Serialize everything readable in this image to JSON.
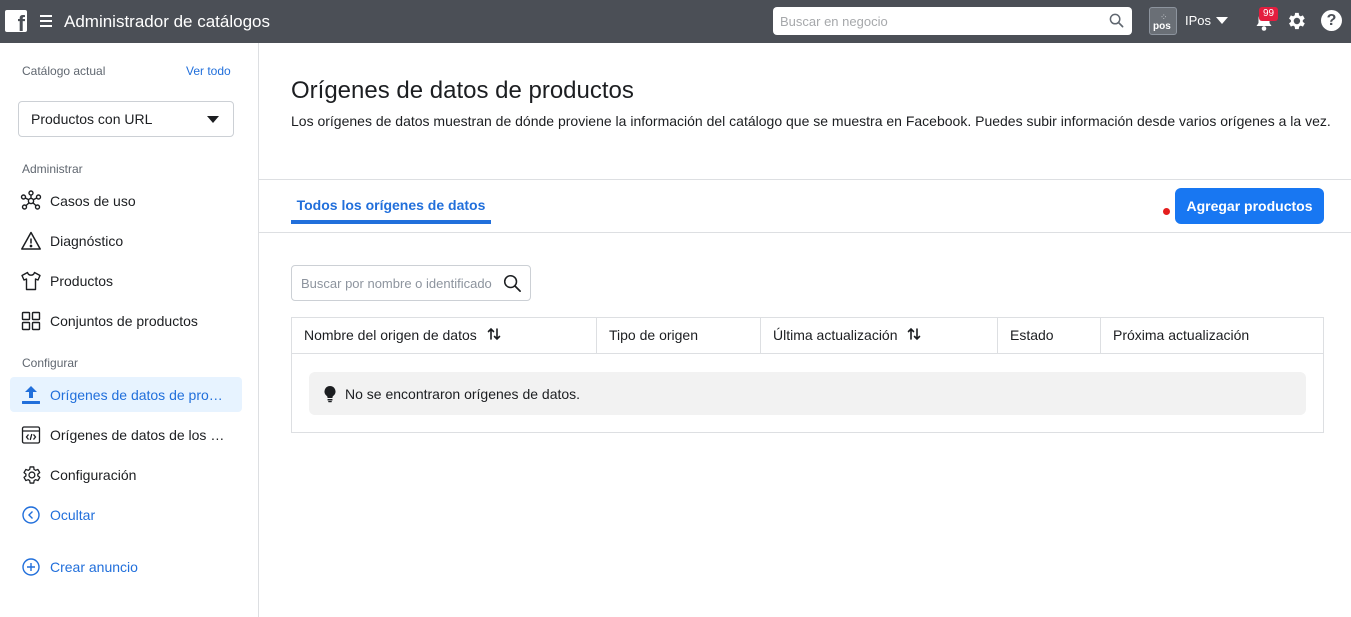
{
  "topbar": {
    "logo_letter": "f",
    "app_title": "Administrador de catálogos",
    "search_placeholder": "Buscar en negocio",
    "business_avatar_text": "pos",
    "business_name": "IPos",
    "notifications_count": "99"
  },
  "sidebar": {
    "catalog_label": "Catálogo actual",
    "view_all": "Ver todo",
    "catalog_selected": "Productos con URL",
    "sections": {
      "manage": "Administrar",
      "configure": "Configurar"
    },
    "items": [
      {
        "label": "Casos de uso",
        "icon": "use-cases-icon"
      },
      {
        "label": "Diagnóstico",
        "icon": "warning-icon"
      },
      {
        "label": "Productos",
        "icon": "shirt-icon"
      },
      {
        "label": "Conjuntos de productos",
        "icon": "grid-icon"
      },
      {
        "label": "Orígenes de datos de productos",
        "icon": "upload-icon",
        "active": true
      },
      {
        "label": "Orígenes de datos de los eventos",
        "icon": "code-icon"
      },
      {
        "label": "Configuración",
        "icon": "gear-icon"
      },
      {
        "label": "Ocultar",
        "icon": "collapse-icon"
      },
      {
        "label": "Crear anuncio",
        "icon": "plus-circle-icon"
      }
    ]
  },
  "main": {
    "title": "Orígenes de datos de productos",
    "description": "Los orígenes de datos muestran de dónde proviene la información del catálogo que se muestra en Facebook. Puedes subir información desde varios orígenes a la vez.",
    "tab_all": "Todos los orígenes de datos",
    "add_button": "Agregar productos",
    "search_placeholder": "Buscar por nombre o identificador",
    "table": {
      "columns": [
        "Nombre del origen de datos",
        "Tipo de origen",
        "Última actualización",
        "Estado",
        "Próxima actualización"
      ],
      "empty_message": "No se encontraron orígenes de datos."
    }
  },
  "colors": {
    "topbar": "#4b4f56",
    "accent": "#1877f2",
    "link": "#216fdb",
    "badge": "#e41e3f"
  }
}
